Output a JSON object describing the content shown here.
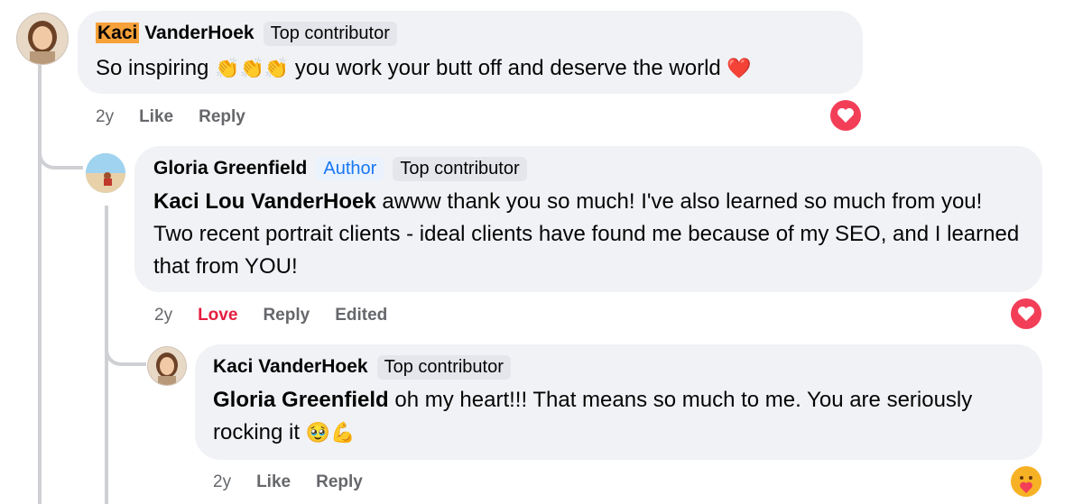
{
  "comments": [
    {
      "name_first": "Kaci",
      "name_rest": " VanderHoek",
      "badge": "Top contributor",
      "text_a": "So inspiring ",
      "emoji_a": "👏👏👏",
      "text_b": " you work your butt off and deserve the world ",
      "emoji_b": "❤️",
      "time": "2y",
      "like": "Like",
      "reply": "Reply",
      "reaction_icon": "heart-reaction-icon"
    },
    {
      "name": "Gloria Greenfield",
      "author": "Author",
      "badge": "Top contributor",
      "mention": "Kaci Lou VanderHoek",
      "text": " awww thank you so much! I've also learned so much from you! Two recent portrait clients - ideal clients have found me because of my SEO, and I learned that from YOU!",
      "time": "2y",
      "love": "Love",
      "reply": "Reply",
      "edited": "Edited",
      "reaction_icon": "heart-reaction-icon"
    },
    {
      "name": "Kaci VanderHoek",
      "badge": "Top contributor",
      "mention": "Gloria Greenfield",
      "text": " oh my heart!!! That means so much to me. You are seriously rocking it ",
      "emoji": "🥹💪",
      "time": "2y",
      "like": "Like",
      "reply": "Reply",
      "reaction_icon": "care-reaction-icon"
    }
  ],
  "colors": {
    "bubble": "#f0f2f5",
    "secondary_text": "#65676b",
    "love": "#e41e3f",
    "author": "#1877f2",
    "highlight": "#f6a13a"
  }
}
